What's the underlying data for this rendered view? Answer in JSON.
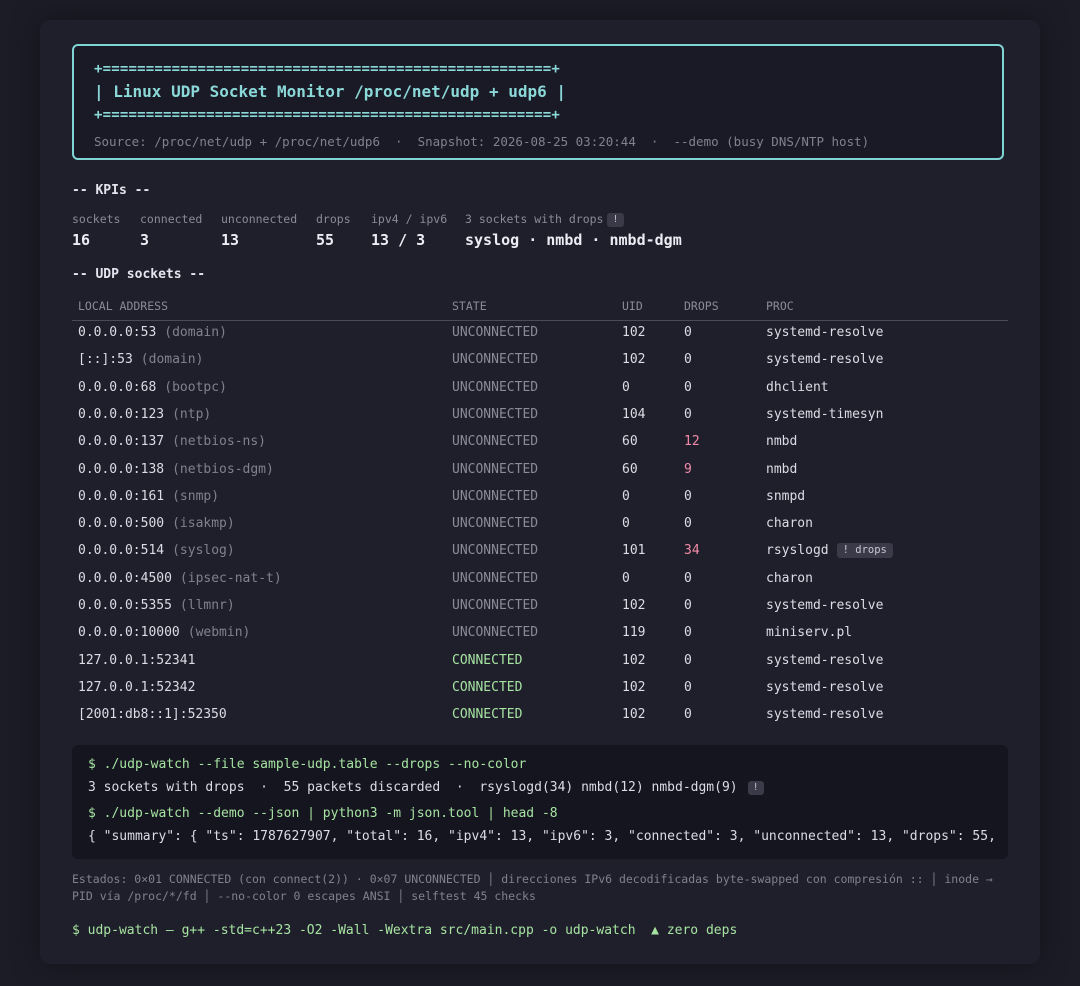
{
  "banner": {
    "rule": "+====================================================+",
    "title": "| Linux UDP Socket Monitor /proc/net/udp + udp6 |",
    "source": "Source: /proc/net/udp + /proc/net/udp6  ·  Snapshot: 2026-08-25 03:20:44  ·  --demo (busy DNS/NTP host)"
  },
  "kpis": {
    "header": "-- KPIs --",
    "items": [
      {
        "label": "sockets",
        "value": "16"
      },
      {
        "label": "connected",
        "value": "3"
      },
      {
        "label": "unconnected",
        "value": "13"
      },
      {
        "label": "drops",
        "value": "55"
      },
      {
        "label": "ipv4 / ipv6",
        "value": "13 / 3"
      },
      {
        "label": "3 sockets with drops",
        "badge": "!",
        "value": "syslog · nmbd · nmbd-dgm"
      }
    ]
  },
  "table": {
    "header": "-- UDP sockets --",
    "columns": [
      "LOCAL ADDRESS",
      "STATE",
      "UID",
      "DROPS",
      "PROC"
    ],
    "rows": [
      {
        "addr": "0.0.0.0:53",
        "svc": "(domain)",
        "state": "UNCONNECTED",
        "uid": "102",
        "drops": "0",
        "proc": "systemd-resolve"
      },
      {
        "addr": "[::]:53",
        "svc": "(domain)",
        "state": "UNCONNECTED",
        "uid": "102",
        "drops": "0",
        "proc": "systemd-resolve"
      },
      {
        "addr": "0.0.0.0:68",
        "svc": "(bootpc)",
        "state": "UNCONNECTED",
        "uid": "0",
        "drops": "0",
        "proc": "dhclient"
      },
      {
        "addr": "0.0.0.0:123",
        "svc": "(ntp)",
        "state": "UNCONNECTED",
        "uid": "104",
        "drops": "0",
        "proc": "systemd-timesyn"
      },
      {
        "addr": "0.0.0.0:137",
        "svc": "(netbios-ns)",
        "state": "UNCONNECTED",
        "uid": "60",
        "drops": "12",
        "proc": "nmbd"
      },
      {
        "addr": "0.0.0.0:138",
        "svc": "(netbios-dgm)",
        "state": "UNCONNECTED",
        "uid": "60",
        "drops": "9",
        "proc": "nmbd"
      },
      {
        "addr": "0.0.0.0:161",
        "svc": "(snmp)",
        "state": "UNCONNECTED",
        "uid": "0",
        "drops": "0",
        "proc": "snmpd"
      },
      {
        "addr": "0.0.0.0:500",
        "svc": "(isakmp)",
        "state": "UNCONNECTED",
        "uid": "0",
        "drops": "0",
        "proc": "charon"
      },
      {
        "addr": "0.0.0.0:514",
        "svc": "(syslog)",
        "state": "UNCONNECTED",
        "uid": "101",
        "drops": "34",
        "proc": "rsyslogd",
        "badge": "! drops"
      },
      {
        "addr": "0.0.0.0:4500",
        "svc": "(ipsec-nat-t)",
        "state": "UNCONNECTED",
        "uid": "0",
        "drops": "0",
        "proc": "charon"
      },
      {
        "addr": "0.0.0.0:5355",
        "svc": "(llmnr)",
        "state": "UNCONNECTED",
        "uid": "102",
        "drops": "0",
        "proc": "systemd-resolve"
      },
      {
        "addr": "0.0.0.0:10000",
        "svc": "(webmin)",
        "state": "UNCONNECTED",
        "uid": "119",
        "drops": "0",
        "proc": "miniserv.pl"
      },
      {
        "addr": "127.0.0.1:52341",
        "svc": "",
        "state": "CONNECTED",
        "uid": "102",
        "drops": "0",
        "proc": "systemd-resolve"
      },
      {
        "addr": "127.0.0.1:52342",
        "svc": "",
        "state": "CONNECTED",
        "uid": "102",
        "drops": "0",
        "proc": "systemd-resolve"
      },
      {
        "addr": "[2001:db8::1]:52350",
        "svc": "",
        "state": "CONNECTED",
        "uid": "102",
        "drops": "0",
        "proc": "systemd-resolve"
      }
    ]
  },
  "terminal": {
    "cmd1": "$ ./udp-watch --file sample-udp.table --drops --no-color",
    "out1": "3 sockets with drops  ·  55 packets discarded  ·  rsyslogd(34) nmbd(12) nmbd-dgm(9)",
    "out1_badge": "!",
    "cmd2": "$ ./udp-watch --demo --json | python3 -m json.tool | head -8",
    "out2": "{ \"summary\": { \"ts\": 1787627907, \"total\": 16, \"ipv4\": 13, \"ipv6\": 3, \"connected\": 3, \"unconnected\": 13, \"drops\": 55,"
  },
  "footer": "Estados: 0×01 CONNECTED (con connect(2)) · 0×07 UNCONNECTED  │  direcciones IPv6 decodificadas byte-swapped con compresión ::  │  inode → PID vía /proc/*/fd  │  --no-color 0 escapes ANSI  │  selftest 45 checks",
  "build": "$ udp-watch — g++ -std=c++23 -O2 -Wall -Wextra src/main.cpp -o udp-watch  ▲ zero deps",
  "colors": {
    "accent": "#8bd8d8",
    "connected": "#a6e3a1",
    "drops": "#f38ba8",
    "muted": "#80808f"
  }
}
